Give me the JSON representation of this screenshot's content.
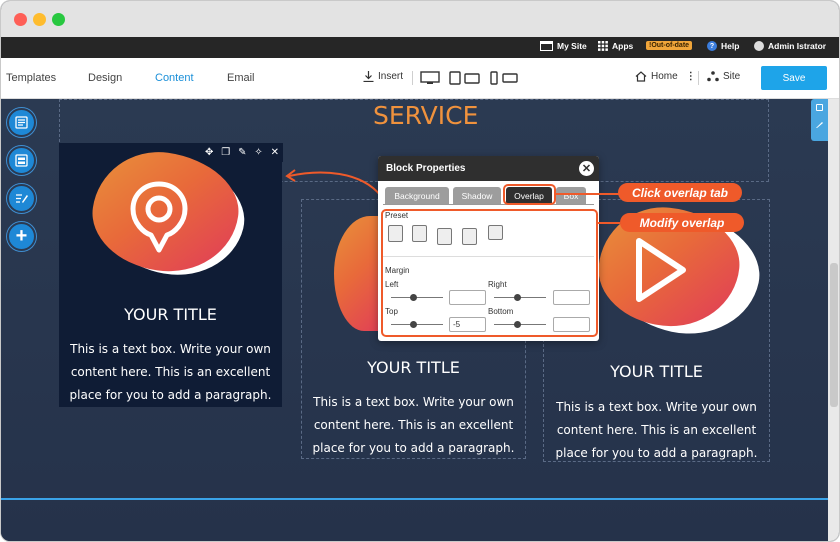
{
  "window": {
    "title": ""
  },
  "topbar": {
    "my_site": "My Site",
    "apps": "Apps",
    "out_of_date": "!Out-of-date",
    "help": "Help",
    "user": "Admin Istrator"
  },
  "toolbar": {
    "tabs": [
      "Templates",
      "Design",
      "Content",
      "Email"
    ],
    "active_tab": "Content",
    "insert_label": "Insert",
    "home_label": "Home",
    "site_label": "Site",
    "save_label": "Save"
  },
  "page": {
    "section_title": "SERVICE",
    "cards": [
      {
        "title": "YOUR TITLE",
        "text": "This is a text box. Write your own content here. This is an excellent place for you to add a paragraph."
      },
      {
        "title": "YOUR TITLE",
        "text": "This is a text box. Write your own content here. This is an excellent place for you to add a paragraph."
      },
      {
        "title": "YOUR TITLE",
        "text": "This is a text box. Write your own content here. This is an excellent place for you to add a paragraph."
      }
    ]
  },
  "block_properties": {
    "title": "Block Properties",
    "tabs": [
      "Background",
      "Shadow",
      "Overlap",
      "Box"
    ],
    "active_tab": "Overlap",
    "preset_label": "Preset",
    "margin_label": "Margin",
    "left_label": "Left",
    "right_label": "Right",
    "top_label": "Top",
    "bottom_label": "Bottom",
    "left_value": "",
    "right_value": "",
    "top_value": "-5",
    "bottom_value": ""
  },
  "annotations": {
    "click_overlap_tab": "Click overlap tab",
    "modify_overlap": "Modify overlap"
  },
  "colors": {
    "accent": "#1ea4e9",
    "callout": "#ef5a2a",
    "section_title": "#f0923d",
    "canvas_bg": "#2a3446"
  }
}
